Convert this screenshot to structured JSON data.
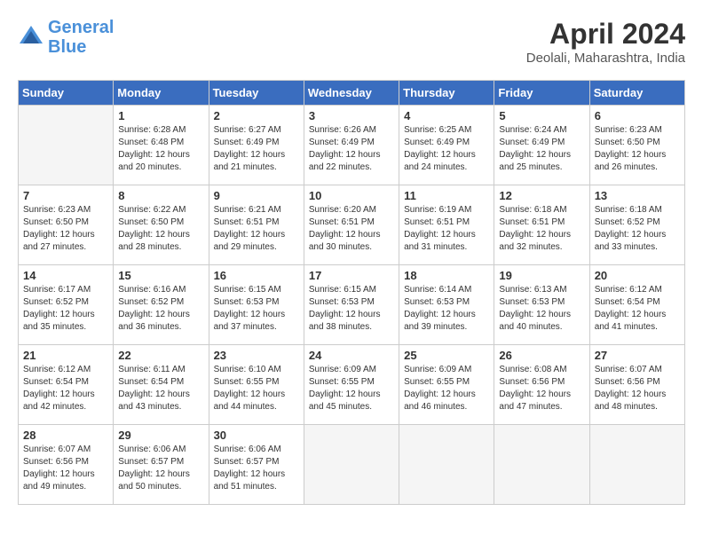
{
  "logo": {
    "line1": "General",
    "line2": "Blue"
  },
  "title": "April 2024",
  "location": "Deolali, Maharashtra, India",
  "days_of_week": [
    "Sunday",
    "Monday",
    "Tuesday",
    "Wednesday",
    "Thursday",
    "Friday",
    "Saturday"
  ],
  "weeks": [
    [
      {
        "day": "",
        "info": ""
      },
      {
        "day": "1",
        "info": "Sunrise: 6:28 AM\nSunset: 6:48 PM\nDaylight: 12 hours\nand 20 minutes."
      },
      {
        "day": "2",
        "info": "Sunrise: 6:27 AM\nSunset: 6:49 PM\nDaylight: 12 hours\nand 21 minutes."
      },
      {
        "day": "3",
        "info": "Sunrise: 6:26 AM\nSunset: 6:49 PM\nDaylight: 12 hours\nand 22 minutes."
      },
      {
        "day": "4",
        "info": "Sunrise: 6:25 AM\nSunset: 6:49 PM\nDaylight: 12 hours\nand 24 minutes."
      },
      {
        "day": "5",
        "info": "Sunrise: 6:24 AM\nSunset: 6:49 PM\nDaylight: 12 hours\nand 25 minutes."
      },
      {
        "day": "6",
        "info": "Sunrise: 6:23 AM\nSunset: 6:50 PM\nDaylight: 12 hours\nand 26 minutes."
      }
    ],
    [
      {
        "day": "7",
        "info": "Sunrise: 6:23 AM\nSunset: 6:50 PM\nDaylight: 12 hours\nand 27 minutes."
      },
      {
        "day": "8",
        "info": "Sunrise: 6:22 AM\nSunset: 6:50 PM\nDaylight: 12 hours\nand 28 minutes."
      },
      {
        "day": "9",
        "info": "Sunrise: 6:21 AM\nSunset: 6:51 PM\nDaylight: 12 hours\nand 29 minutes."
      },
      {
        "day": "10",
        "info": "Sunrise: 6:20 AM\nSunset: 6:51 PM\nDaylight: 12 hours\nand 30 minutes."
      },
      {
        "day": "11",
        "info": "Sunrise: 6:19 AM\nSunset: 6:51 PM\nDaylight: 12 hours\nand 31 minutes."
      },
      {
        "day": "12",
        "info": "Sunrise: 6:18 AM\nSunset: 6:51 PM\nDaylight: 12 hours\nand 32 minutes."
      },
      {
        "day": "13",
        "info": "Sunrise: 6:18 AM\nSunset: 6:52 PM\nDaylight: 12 hours\nand 33 minutes."
      }
    ],
    [
      {
        "day": "14",
        "info": "Sunrise: 6:17 AM\nSunset: 6:52 PM\nDaylight: 12 hours\nand 35 minutes."
      },
      {
        "day": "15",
        "info": "Sunrise: 6:16 AM\nSunset: 6:52 PM\nDaylight: 12 hours\nand 36 minutes."
      },
      {
        "day": "16",
        "info": "Sunrise: 6:15 AM\nSunset: 6:53 PM\nDaylight: 12 hours\nand 37 minutes."
      },
      {
        "day": "17",
        "info": "Sunrise: 6:15 AM\nSunset: 6:53 PM\nDaylight: 12 hours\nand 38 minutes."
      },
      {
        "day": "18",
        "info": "Sunrise: 6:14 AM\nSunset: 6:53 PM\nDaylight: 12 hours\nand 39 minutes."
      },
      {
        "day": "19",
        "info": "Sunrise: 6:13 AM\nSunset: 6:53 PM\nDaylight: 12 hours\nand 40 minutes."
      },
      {
        "day": "20",
        "info": "Sunrise: 6:12 AM\nSunset: 6:54 PM\nDaylight: 12 hours\nand 41 minutes."
      }
    ],
    [
      {
        "day": "21",
        "info": "Sunrise: 6:12 AM\nSunset: 6:54 PM\nDaylight: 12 hours\nand 42 minutes."
      },
      {
        "day": "22",
        "info": "Sunrise: 6:11 AM\nSunset: 6:54 PM\nDaylight: 12 hours\nand 43 minutes."
      },
      {
        "day": "23",
        "info": "Sunrise: 6:10 AM\nSunset: 6:55 PM\nDaylight: 12 hours\nand 44 minutes."
      },
      {
        "day": "24",
        "info": "Sunrise: 6:09 AM\nSunset: 6:55 PM\nDaylight: 12 hours\nand 45 minutes."
      },
      {
        "day": "25",
        "info": "Sunrise: 6:09 AM\nSunset: 6:55 PM\nDaylight: 12 hours\nand 46 minutes."
      },
      {
        "day": "26",
        "info": "Sunrise: 6:08 AM\nSunset: 6:56 PM\nDaylight: 12 hours\nand 47 minutes."
      },
      {
        "day": "27",
        "info": "Sunrise: 6:07 AM\nSunset: 6:56 PM\nDaylight: 12 hours\nand 48 minutes."
      }
    ],
    [
      {
        "day": "28",
        "info": "Sunrise: 6:07 AM\nSunset: 6:56 PM\nDaylight: 12 hours\nand 49 minutes."
      },
      {
        "day": "29",
        "info": "Sunrise: 6:06 AM\nSunset: 6:57 PM\nDaylight: 12 hours\nand 50 minutes."
      },
      {
        "day": "30",
        "info": "Sunrise: 6:06 AM\nSunset: 6:57 PM\nDaylight: 12 hours\nand 51 minutes."
      },
      {
        "day": "",
        "info": ""
      },
      {
        "day": "",
        "info": ""
      },
      {
        "day": "",
        "info": ""
      },
      {
        "day": "",
        "info": ""
      }
    ]
  ]
}
